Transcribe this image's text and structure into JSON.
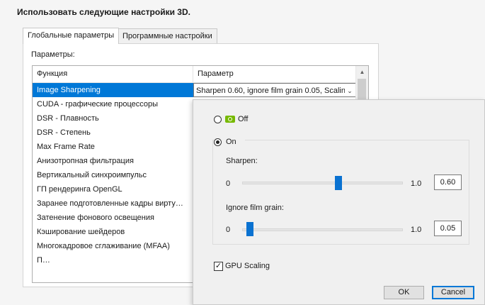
{
  "page": {
    "heading": "Использовать следующие настройки 3D."
  },
  "tabs": [
    {
      "label": "Глобальные параметры",
      "active": true
    },
    {
      "label": "Программные настройки",
      "active": false
    }
  ],
  "panel": {
    "params_label": "Параметры:",
    "columns": [
      "Функция",
      "Параметр"
    ],
    "selected_value": "Sharpen 0.60, ignore film grain 0.05, Scalin",
    "rows": [
      "Image Sharpening",
      "CUDA - графические процессоры",
      "DSR - Плавность",
      "DSR - Степень",
      "Max Frame Rate",
      "Анизотропная фильтрация",
      "Вертикальный синхроимпульс",
      "ГП рендеринга OpenGL",
      "Заранее подготовленные кадры вирту…",
      "Затенение фонового освещения",
      "Кэширование шейдеров",
      "Многокадровое сглаживание (MFAA)",
      "П…"
    ]
  },
  "popup": {
    "off_label": "Off",
    "on_label": "On",
    "selected_option": "On",
    "sharpen": {
      "label": "Sharpen:",
      "min": "0",
      "max": "1.0",
      "value": "0.60",
      "level": 0.6
    },
    "film_grain": {
      "label": "Ignore film grain:",
      "min": "0",
      "max": "1.0",
      "value": "0.05",
      "level": 0.05
    },
    "gpu_scaling": {
      "label": "GPU Scaling",
      "checked": true
    },
    "ok_label": "OK",
    "cancel_label": "Cancel"
  },
  "colors": {
    "selection": "#0078d7",
    "slider_thumb": "#0a72d1",
    "nvidia_green": "#76b900"
  },
  "icons": {
    "nvidia": "nvidia-logo-icon",
    "dropdown": "chevron-down-icon",
    "scroll_up": "scroll-up-arrow-icon"
  }
}
